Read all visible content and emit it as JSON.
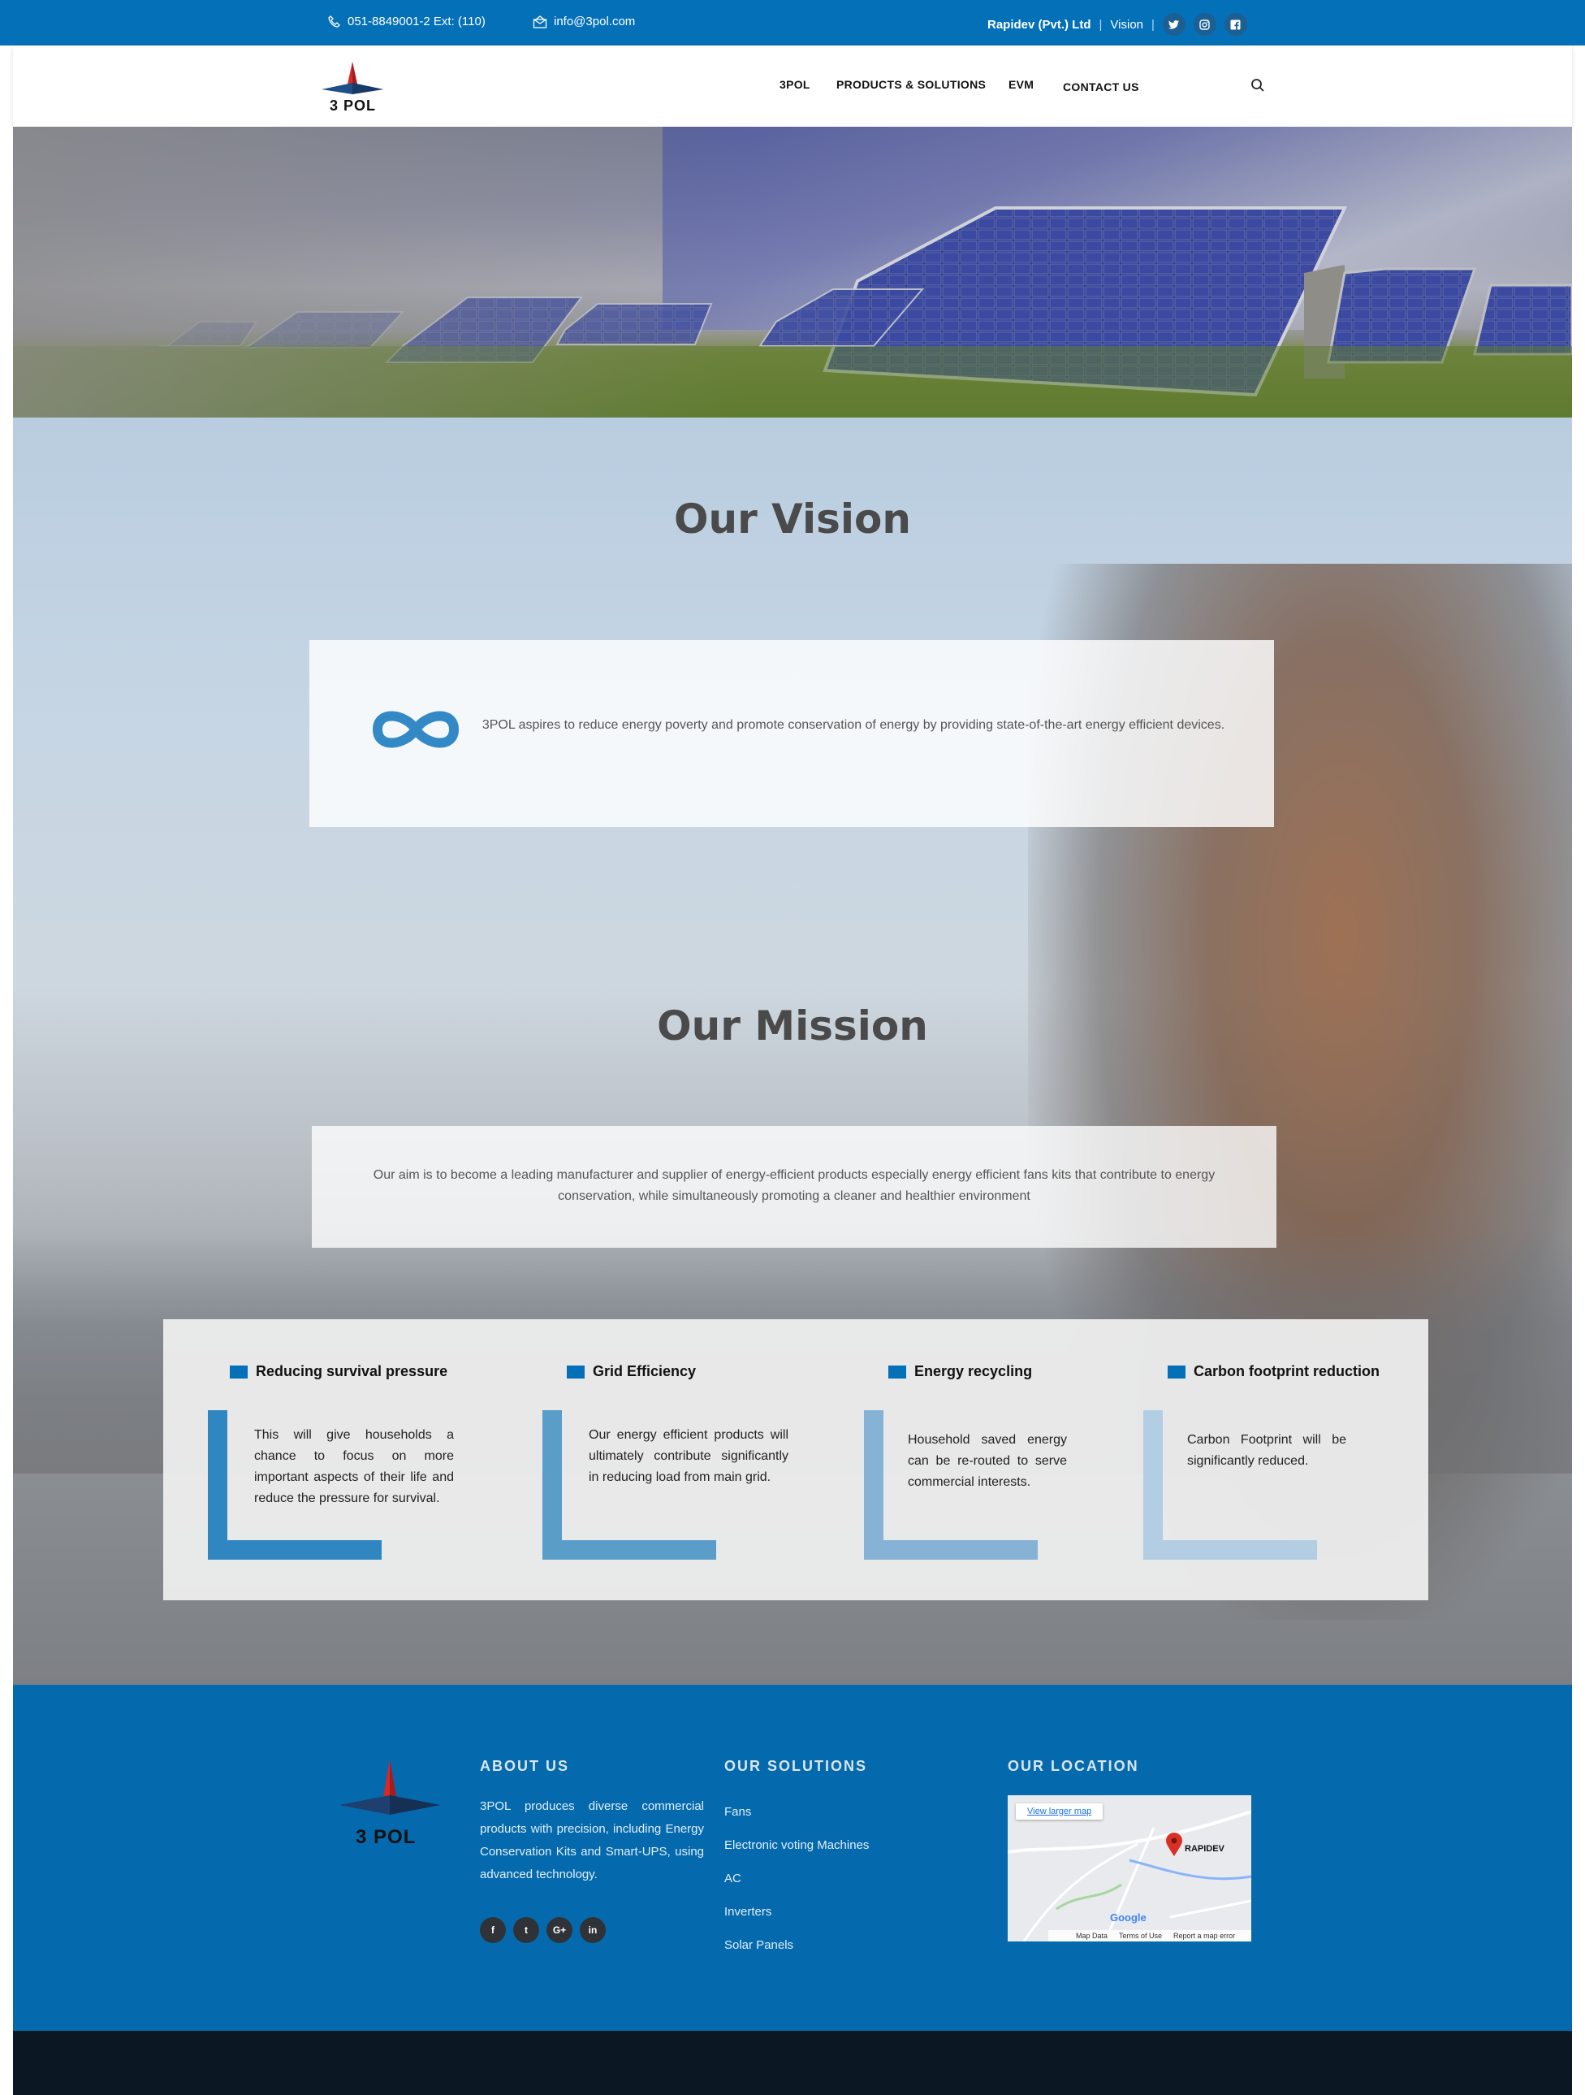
{
  "topbar": {
    "phone": "051-8849001-2 Ext: (110)",
    "email": "info@3pol.com",
    "company": "Rapidev (Pvt.) Ltd",
    "page": "Vision",
    "social": [
      "twitter-icon",
      "instagram-icon",
      "facebook-icon"
    ]
  },
  "header": {
    "logo_text": "3 POL",
    "nav": [
      "3POL",
      "PRODUCTS & SOLUTIONS",
      "EVM",
      "CONTACT US"
    ]
  },
  "vision": {
    "title": "Our Vision",
    "text": "3POL aspires to reduce energy poverty and promote conservation of energy by providing state-of-the-art energy efficient devices."
  },
  "mission": {
    "title": "Our Mission",
    "text": "Our aim is to become a leading manufacturer and supplier of energy-efficient products especially energy efficient fans kits that contribute to energy conservation, while simultaneously promoting a cleaner and healthier environment"
  },
  "features": [
    {
      "title": "Reducing survival pressure",
      "text": "This will give households a chance to focus on more important aspects of their life and reduce the pressure for survival.",
      "color": "#2f86c1"
    },
    {
      "title": "Grid Efficiency",
      "text": "Our energy efficient products will ultimately contribute significantly in reducing load from main grid.",
      "color": "#5a9dc9"
    },
    {
      "title": "Energy recycling",
      "text": "Household saved energy can be re-routed to serve commercial interests.",
      "color": "#86b3d5"
    },
    {
      "title": "Carbon footprint reduction",
      "text": "Carbon Footprint will be significantly reduced.",
      "color": "#b3cde2"
    }
  ],
  "footer": {
    "logo_text": "3 POL",
    "about_title": "ABOUT US",
    "about_text": "3POL produces diverse commercial products with precision, including Energy Conservation Kits and Smart-UPS, using advanced technology.",
    "solutions_title": "OUR SOLUTIONS",
    "solutions": [
      "Fans",
      "Electronic voting Machines",
      "AC",
      "Inverters",
      "Solar Panels"
    ],
    "location_title": "OUR LOCATION",
    "social": [
      "f",
      "t",
      "G+",
      "in"
    ],
    "map": {
      "button": "View larger map",
      "pin_label": "RAPIDEV",
      "google": "Google",
      "footer_links": [
        "Map Data",
        "Terms of Use",
        "Report a map error"
      ]
    }
  }
}
